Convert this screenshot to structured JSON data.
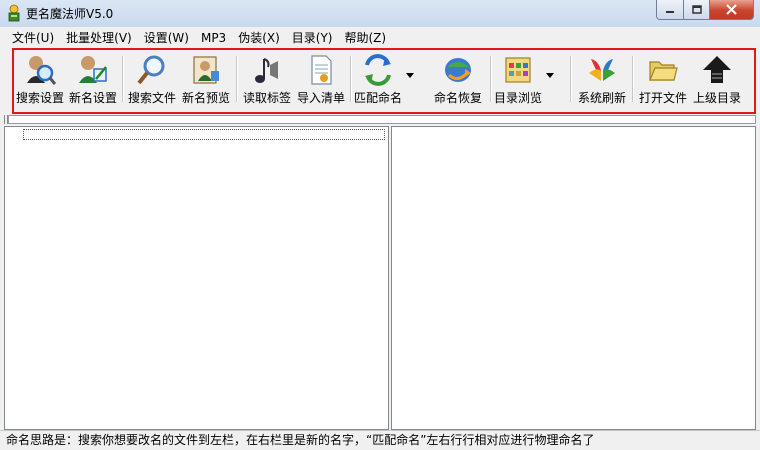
{
  "window": {
    "title": "更名魔法师V5.0"
  },
  "menu": [
    "文件(U)",
    "批量处理(V)",
    "设置(W)",
    "MP3",
    "伪装(X)",
    "目录(Y)",
    "帮助(Z)"
  ],
  "toolbar": {
    "search_settings": "搜索设置",
    "rename_settings": "新名设置",
    "search_files": "搜索文件",
    "preview_names": "新名预览",
    "read_tags": "读取标签",
    "import_list": "导入清单",
    "match_rename": "匹配命名",
    "restore_names": "命名恢复",
    "browse_dirs": "目录浏览",
    "system_refresh": "系统刷新",
    "open_file": "打开文件",
    "parent_dir": "上级目录"
  },
  "status_text": "命名思路是：搜索你想要改名的文件到左栏，在右栏里是新的名字，“匹配命名”左右行行相对应进行物理命名了",
  "colors": {
    "highlight_border": "#e01818",
    "title_bg": "#c9d9ee",
    "close_button": "#c7452d"
  }
}
